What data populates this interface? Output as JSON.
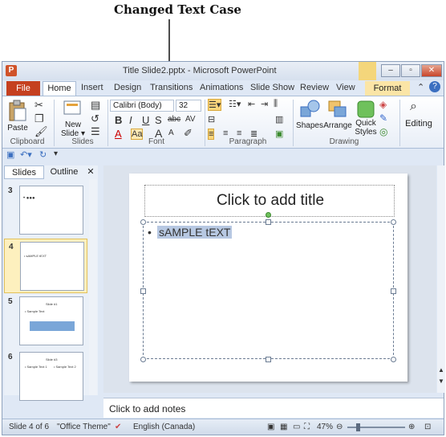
{
  "annotation": {
    "title": "Changed Text Case"
  },
  "window": {
    "title": "Title Slide2.pptx - Microsoft PowerPoint",
    "app_icon": "P",
    "controls": {
      "minimize": "–",
      "maximize": "▫",
      "close": "✕"
    }
  },
  "tabs": {
    "file": "File",
    "home": "Home",
    "insert": "Insert",
    "design": "Design",
    "transitions": "Transitions",
    "animations": "Animations",
    "slide_show": "Slide Show",
    "review": "Review",
    "view": "View",
    "format": "Format"
  },
  "ribbon": {
    "clipboard": {
      "paste": "Paste",
      "label": "Clipboard"
    },
    "slides": {
      "new_slide": "New Slide ▾",
      "label": "Slides"
    },
    "font": {
      "font_name": "Calibri (Body)",
      "font_size": "32",
      "label": "Font",
      "bold": "B",
      "italic": "I",
      "underline": "U",
      "shadow": "S",
      "strike": "abc",
      "spacing": "AV",
      "font_color": "A",
      "case": "Aa",
      "grow": "A",
      "shrink": "A"
    },
    "paragraph": {
      "label": "Paragraph"
    },
    "drawing": {
      "shapes": "Shapes",
      "arrange": "Arrange",
      "quick_styles": "Quick Styles",
      "label": "Drawing"
    },
    "editing": {
      "label": "Editing"
    }
  },
  "pane": {
    "tab_slides": "Slides",
    "tab_outline": "Outline",
    "close": "✕",
    "thumbs": [
      {
        "num": "3",
        "text": "• ●●●"
      },
      {
        "num": "4",
        "text": "• sAMPLE tEXT"
      },
      {
        "num": "5",
        "title": "Slide #1",
        "bullet": "• Sample Text"
      },
      {
        "num": "6",
        "title": "Slide #3",
        "bullet": "• Sample Text 1",
        "bullet2": "• Sample Text 2"
      }
    ]
  },
  "slide": {
    "title_placeholder": "Click to add title",
    "bullet": "•",
    "content_text": "sAMPLE tEXT"
  },
  "notes": {
    "placeholder": "Click to add notes"
  },
  "status": {
    "slide_info": "Slide 4 of 6",
    "theme": "\"Office Theme\"",
    "language": "English (Canada)",
    "zoom": "47%"
  },
  "colors": {
    "file_tab": "#c5401f",
    "format_tab": "#fbe5a6",
    "selection": "#b7c8e2"
  }
}
